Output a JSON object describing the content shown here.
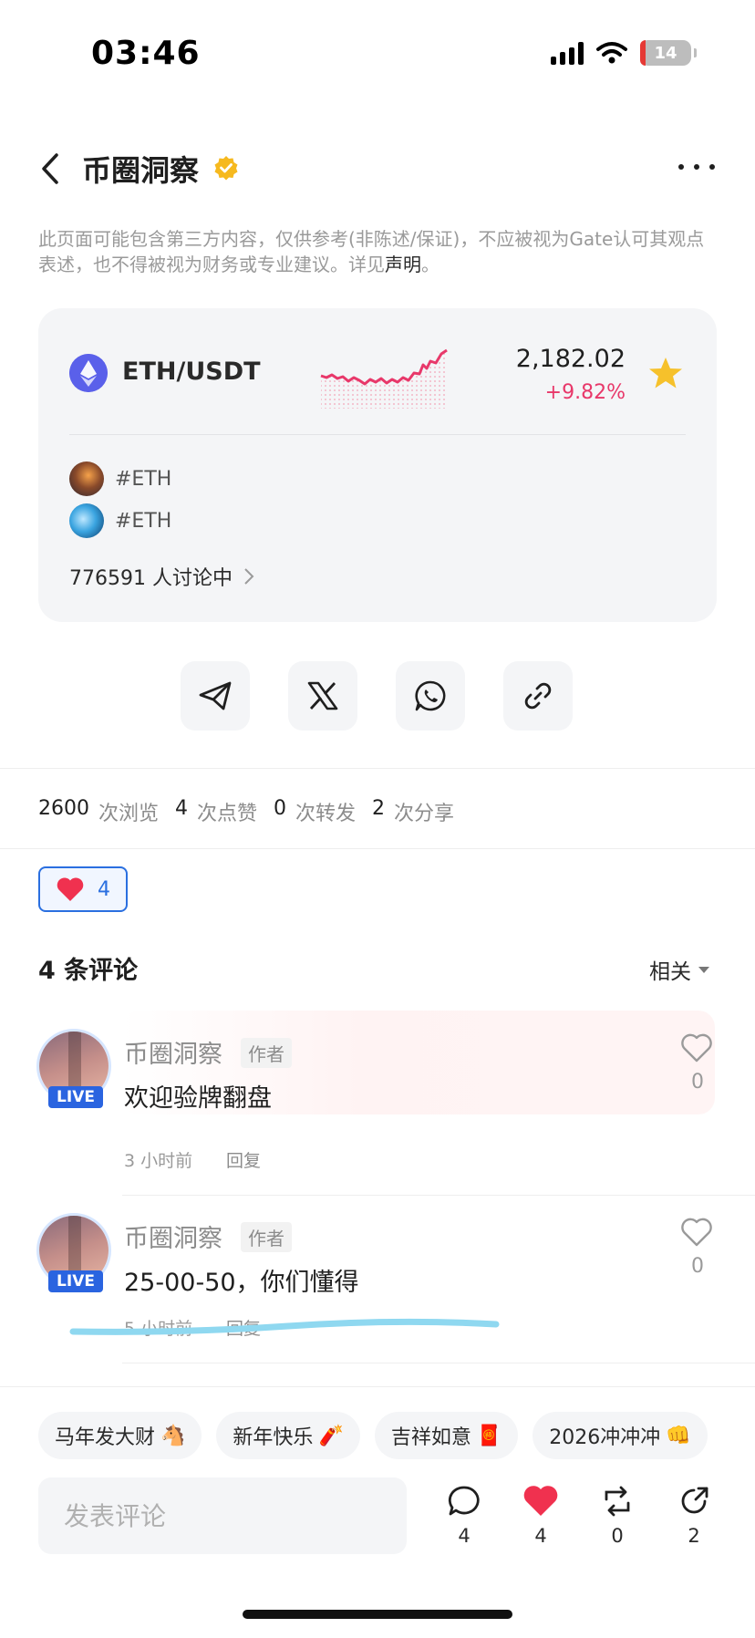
{
  "status_bar": {
    "time": "03:46",
    "battery": "14"
  },
  "header": {
    "title": "币圈洞察"
  },
  "disclaimer": {
    "text": "此页面可能包含第三方内容，仅供参考(非陈述/保证)，不应被视为Gate认可其观点表述，也不得被视为财务或专业建议。详见",
    "link": "声明",
    "end": "。"
  },
  "market_card": {
    "pair": "ETH/USDT",
    "price": "2,182.02",
    "change": "+9.82%",
    "topics": [
      {
        "label": "#ETH"
      },
      {
        "label": "#ETH"
      }
    ],
    "discussing": "776591 人讨论中"
  },
  "stats": {
    "views": "2600",
    "views_label": "次浏览",
    "likes": "4",
    "likes_label": "次点赞",
    "reposts": "0",
    "reposts_label": "次转发",
    "shares": "2",
    "shares_label": "次分享"
  },
  "like_chip": {
    "count": "4"
  },
  "comments": {
    "title": "4 条评论",
    "sort": "相关",
    "items": [
      {
        "author": "币圈洞察",
        "tag": "作者",
        "badge": "LIVE",
        "text": "欢迎验牌翻盘",
        "time": "3 小时前",
        "reply": "回复",
        "likes": "0"
      },
      {
        "author": "币圈洞察",
        "tag": "作者",
        "badge": "LIVE",
        "text": "25-00-50，你们懂得",
        "time": "5 小时前",
        "reply": "回复",
        "likes": "0"
      }
    ]
  },
  "quick_phrases": [
    {
      "text": "马年发大财",
      "emoji": "🐴"
    },
    {
      "text": "新年快乐",
      "emoji": "🧨"
    },
    {
      "text": "吉祥如意",
      "emoji": "🧧"
    },
    {
      "text": "2026冲冲冲",
      "emoji": "👊"
    }
  ],
  "composer": {
    "placeholder": "发表评论"
  },
  "actions": {
    "comments": "4",
    "likes": "4",
    "reposts": "0",
    "shares": "2"
  },
  "colors": {
    "accent_blue": "#2a6fe0",
    "up_pink": "#e8386a",
    "star": "#f6c12b",
    "heart": "#f0314f"
  }
}
